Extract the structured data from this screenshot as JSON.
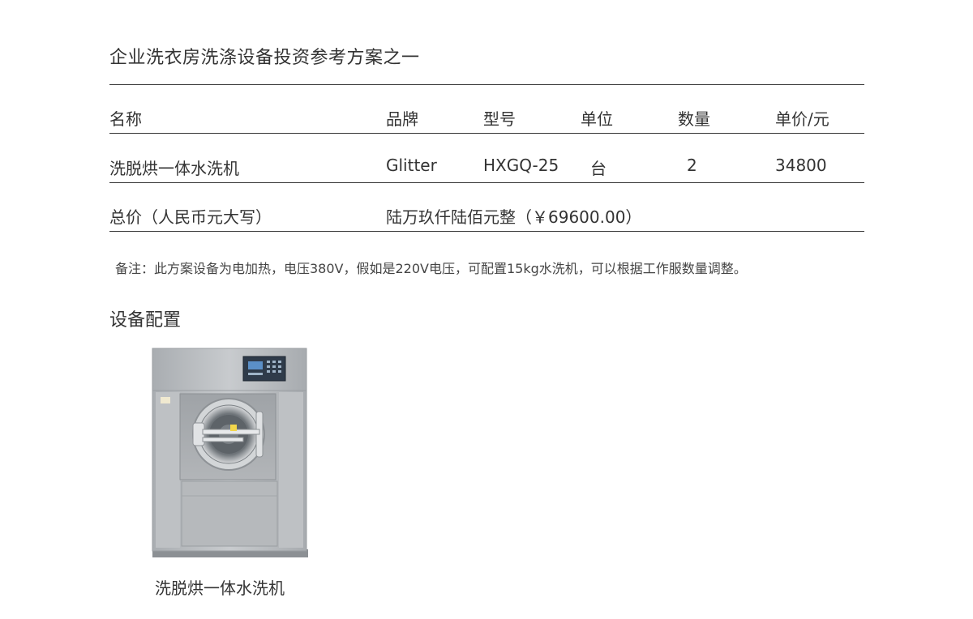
{
  "page": {
    "title": "企业洗衣房洗涤设备投资参考方案之一"
  },
  "table": {
    "headers": [
      "名称",
      "品牌",
      "型号",
      "单位",
      "数量",
      "单价/元"
    ],
    "rows": [
      [
        "洗脱烘一体水洗机",
        "Glitter",
        "HXGQ-25",
        "台",
        "2",
        "34800"
      ]
    ],
    "total_label": "总价（人民币元大写）",
    "total_value": "陆万玖仟陆佰元整（￥69600.00）"
  },
  "note": "备注：此方案设备为电加热，电压380V，假如是220V电压，可配置15kg水洗机，可以根据工作服数量调整。",
  "equipment": {
    "section_title": "设备配置",
    "items": [
      {
        "caption": "洗脱烘一体水洗机",
        "icon": "washing-machine-icon"
      }
    ]
  },
  "colors": {
    "text": "#333333",
    "rule": "#333333",
    "machine_body": "#b9bcbf",
    "panel": "#3a4a5c"
  }
}
